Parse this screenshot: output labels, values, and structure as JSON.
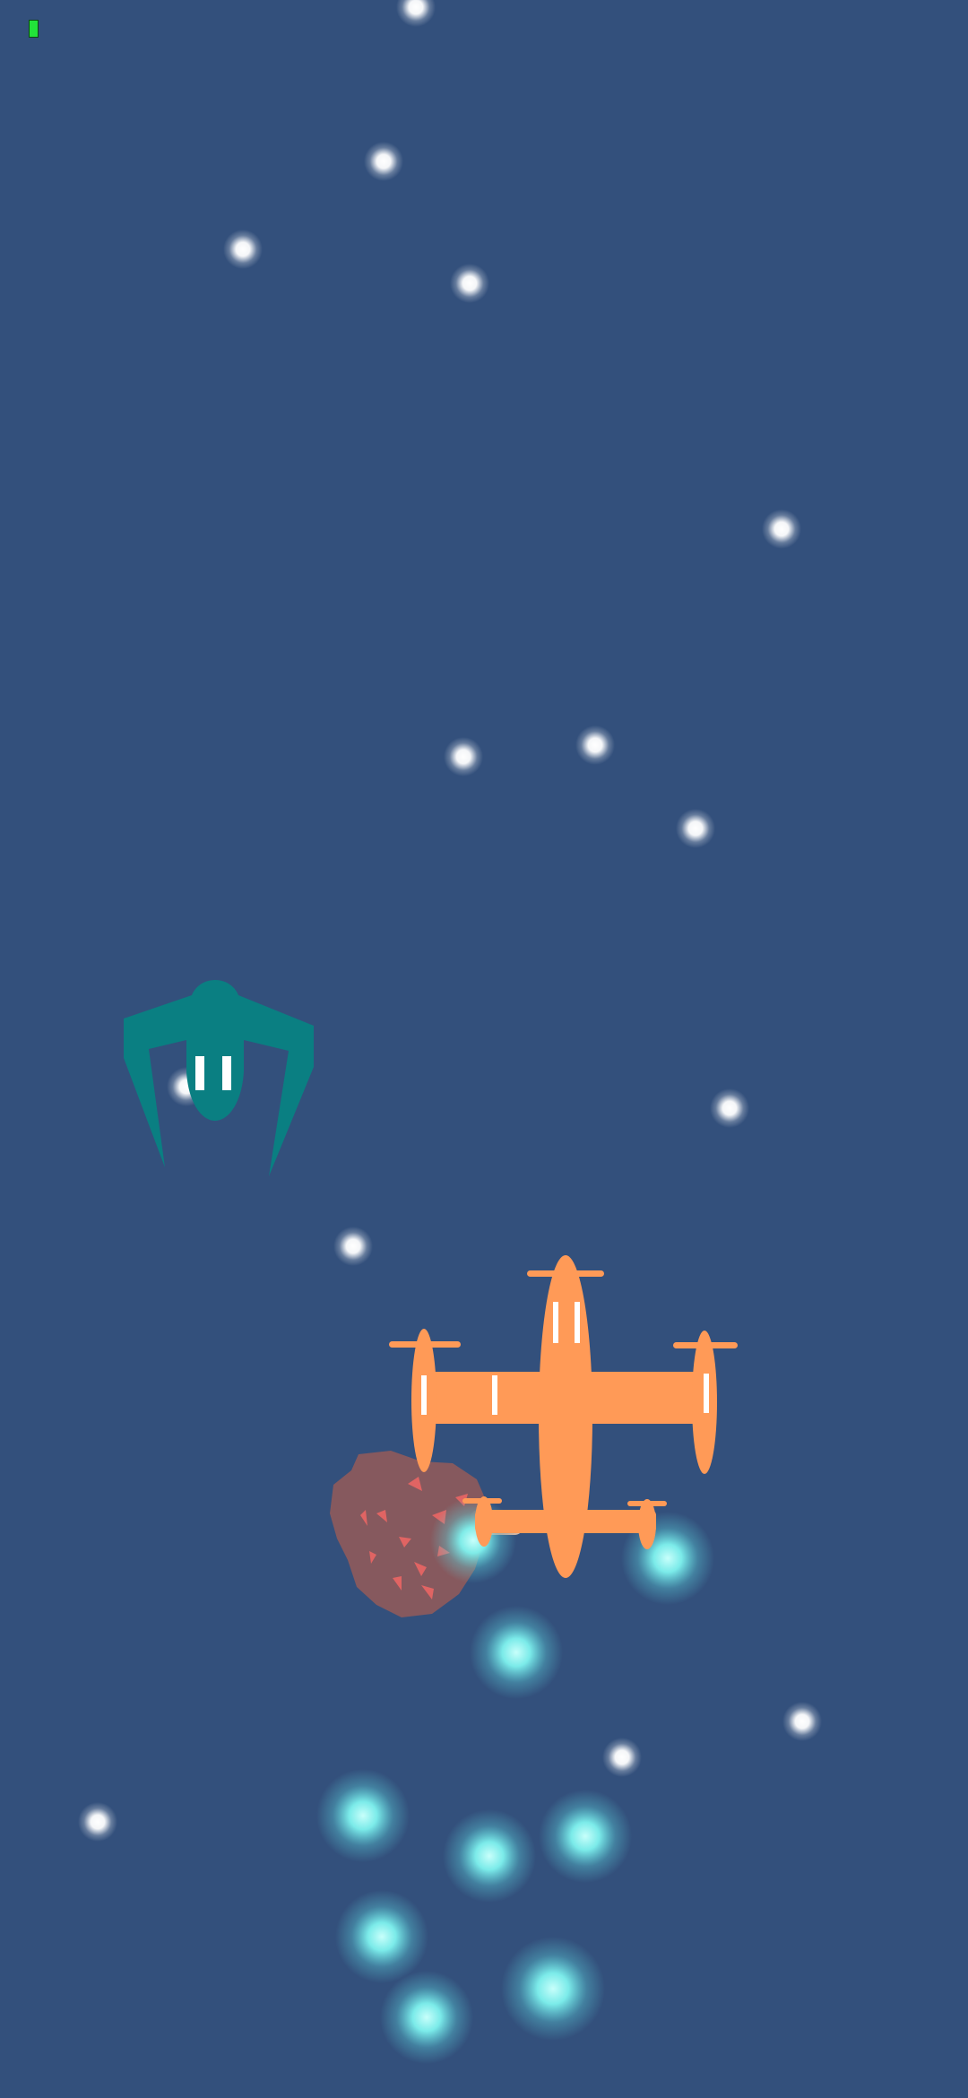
{
  "colors": {
    "background": "#33507c",
    "star": "#ffffff",
    "energy_orb": "#7ff3ef",
    "player_plane": "#ff9a57",
    "enemy_ship": "#0a7f82",
    "asteroid": "#8b5a5d",
    "asteroid_spots": "#e06463",
    "health": "#22e33a"
  },
  "hud": {
    "health_fraction": 1.0
  },
  "entities": {
    "player": "orange-twin-engine-plane",
    "enemy": "teal-winged-spaceship",
    "obstacle": "asteroid",
    "pickups": "energy-orbs",
    "background": "starfield"
  }
}
